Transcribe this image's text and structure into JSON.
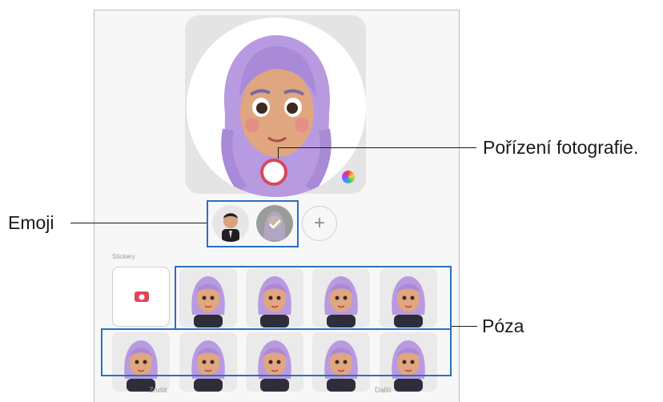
{
  "callouts": {
    "photo": "Pořízení fotografie.",
    "emoji": "Emoji",
    "pose": "Póza"
  },
  "sections": {
    "stickers_label": "Stickery"
  },
  "emoji_bar": {
    "add_label": "+"
  },
  "bottom": {
    "left_label": "Zrušit",
    "right_label": "Další"
  },
  "colors": {
    "highlight": "#2b6fbf",
    "shutter_ring": "#d54a5e",
    "hair": "#b89ae0"
  },
  "pose_tiles": [
    "pose-1",
    "pose-2",
    "pose-3",
    "pose-4",
    "pose-5",
    "pose-6",
    "pose-7",
    "pose-8",
    "pose-9"
  ]
}
